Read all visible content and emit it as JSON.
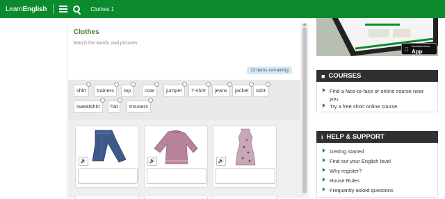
{
  "header": {
    "logo_part1": "Learn",
    "logo_part2": "English",
    "breadcrumb": "Clothes 1",
    "accent_color": "#0b8a2e"
  },
  "exercise": {
    "title": "Clothes",
    "instructions": "Match the words and pictures.",
    "remaining": "12 items remaining",
    "words": [
      "shirt",
      "trainers",
      "top",
      "coat",
      "jumper",
      "T-shirt",
      "jeans",
      "jacket",
      "skirt",
      "sweatshirt",
      "hat",
      "trousers"
    ],
    "cards": [
      {
        "image": "jeans",
        "sound_icon": "speaker-icon",
        "answer": ""
      },
      {
        "image": "jumper",
        "sound_icon": "speaker-icon",
        "answer": ""
      },
      {
        "image": "top",
        "sound_icon": "speaker-icon",
        "answer": ""
      }
    ]
  },
  "ad": {
    "badge_small": "Download on the",
    "badge_big": "App Store"
  },
  "courses": {
    "heading": "COURSES",
    "links": [
      "Find a face-to-face or online course near you",
      "Try a free short online course"
    ]
  },
  "support": {
    "heading": "HELP & SUPPORT",
    "links": [
      "Getting started",
      "Find out your English level",
      "Why register?",
      "House Rules",
      "Frequently asked questions"
    ]
  }
}
